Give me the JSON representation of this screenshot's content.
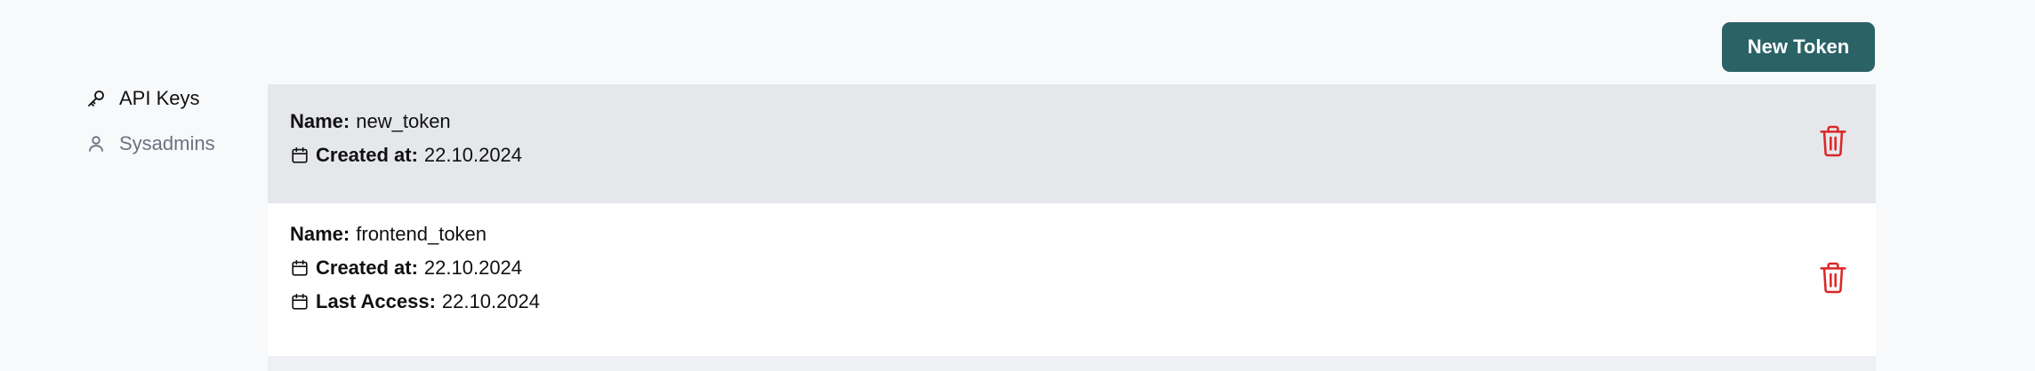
{
  "header": {
    "new_token_label": "New Token"
  },
  "sidebar": {
    "items": [
      {
        "label": "API Keys",
        "icon": "key-icon",
        "active": true
      },
      {
        "label": "Sysadmins",
        "icon": "user-icon",
        "active": false
      }
    ]
  },
  "tokens": [
    {
      "name_label": "Name:",
      "name": "new_token",
      "created_label": "Created at:",
      "created": "22.10.2024"
    },
    {
      "name_label": "Name:",
      "name": "frontend_token",
      "created_label": "Created at:",
      "created": "22.10.2024",
      "access_label": "Last Access:",
      "access": "22.10.2024"
    }
  ],
  "colors": {
    "accent": "#2b6266",
    "danger": "#dc2626",
    "row_shaded": "#e5e7eb",
    "row_white": "#ffffff",
    "inactive_text": "#6b7280"
  }
}
